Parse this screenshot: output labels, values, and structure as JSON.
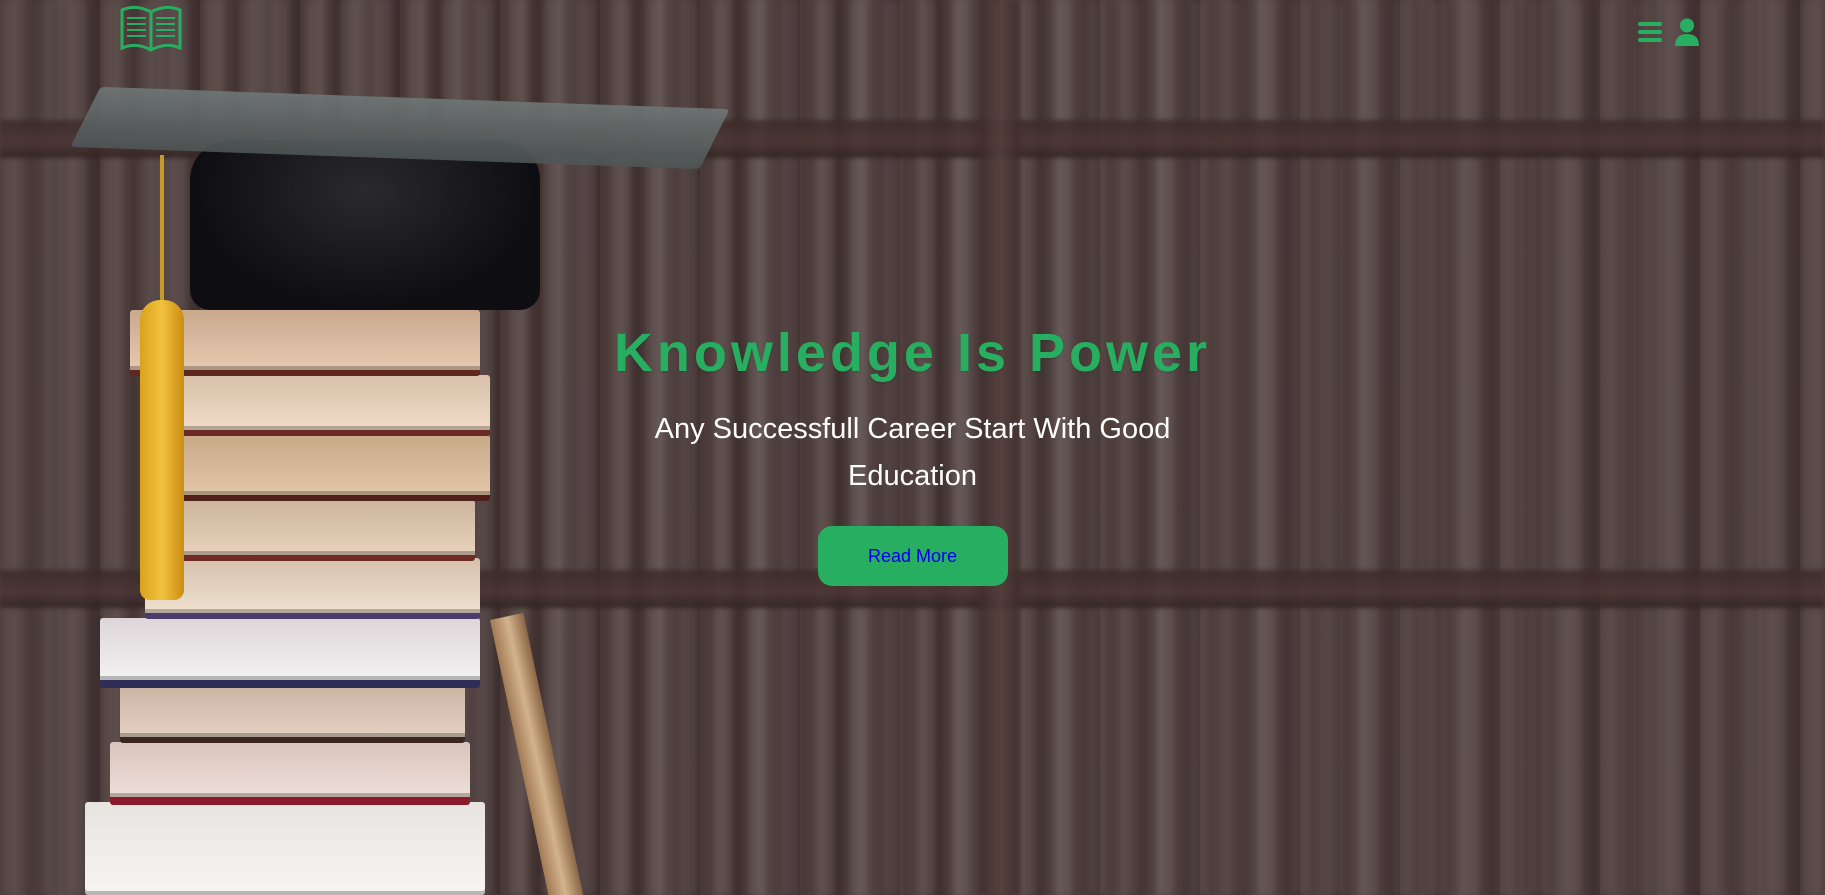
{
  "header": {
    "logo_icon": "open-book-icon",
    "menu_icon": "hamburger-menu-icon",
    "user_icon": "user-icon"
  },
  "hero": {
    "title": "Knowledge Is Power",
    "subtitle": "Any Successfull Career Start With Good Education",
    "cta_label": "Read More"
  },
  "colors": {
    "accent": "#27ae60",
    "link": "#0000ee",
    "text": "#ffffff"
  }
}
